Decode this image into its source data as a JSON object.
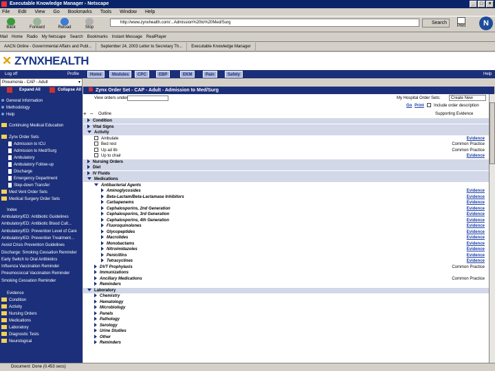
{
  "window": {
    "title": "Executable Knowledge Manager - Netscape"
  },
  "menu": [
    "File",
    "Edit",
    "View",
    "Go",
    "Bookmarks",
    "Tools",
    "Window",
    "Help"
  ],
  "navbar": {
    "back": "Back",
    "forward": "Forward",
    "reload": "Reload",
    "stop": "Stop",
    "url": "http://www.zynxhealth.com/...Admission%20to%20Med/Surg",
    "search": "Search",
    "print": "Print"
  },
  "personal_bar": [
    "Mail",
    "Home",
    "Radio",
    "My Netscape",
    "Search",
    "Bookmarks",
    "Instant Message",
    "RealPlayer"
  ],
  "tabs": [
    "AACN Online - Governmental Affairs and Publ...",
    "September 24, 2003 Letter to Secretary Th...",
    "Executable Knowledge Manager"
  ],
  "brand": {
    "name_a": "ZYNX",
    "name_b": "HEALTH"
  },
  "nav": {
    "logoff": "Log off",
    "profile": "Profile",
    "home": "Home",
    "modules": "Modules",
    "cpc": "CPC",
    "ebp": "EBP",
    "ekm": "EKM",
    "pain": "Pain",
    "safety": "Safety",
    "help": "Help"
  },
  "workflow_select": "Pneumonia - CAP - Adult",
  "left": {
    "expand_all": "Expand All",
    "collapse_all": "Collapse All",
    "top_links": [
      "General Information",
      "Methodology",
      "Help"
    ],
    "continuing": "Continuing Medical Education",
    "order_sets_title": "Zynx Order Sets",
    "order_sets": [
      "Admission to ICU",
      "Admission to Med/Surg",
      "Ambulatory",
      "Ambulatory Follow-up",
      "Discharge",
      "Emergency Department",
      "Step-down Transfer"
    ],
    "other_sets": [
      "Med Vent Order Sets",
      "Medical Surgery Order Sets"
    ],
    "index_title": "Index",
    "index_items": [
      "Ambulatory/ED: Antibiotic Guidelines",
      "Ambulatory/ED: Antibiotic Blood Cult...",
      "Ambulatory/ED: Prevention Level of Care",
      "Ambulatory/ED: Prevention Treatment...",
      "Avoid Crisis Prevention Guidelines",
      "Discharge: Smoking Cessation Reminder",
      "Early Switch to Oral Antibiotics",
      "Influenza Vaccination Reminder",
      "Pneumococcal Vaccination Reminder",
      "Smoking Cessation Reminder"
    ],
    "evidence_title": "Evidence",
    "evidence_items": [
      "Condition",
      "Activity",
      "Nursing Orders",
      "Medications",
      "Laboratory",
      "Diagnostic Tests",
      "Neurological"
    ]
  },
  "main": {
    "header": "Zynx Order Set - CAP - Adult - Admission to Med/Surg",
    "view_label": "View orders under:",
    "my_hospital_label": "My Hospital Order Sets:",
    "create_new": "Create New",
    "go": "Go",
    "print": "Print",
    "include_desc": "Include order description",
    "supporting": "Supporting Evidence",
    "outline_expand": "+",
    "outline_collapse": "−",
    "outline_label": "Outline",
    "evidence_link": "Evidence",
    "common_practice": "Common Practice"
  },
  "orders": [
    {
      "level": 0,
      "label": "Condition",
      "state": "closed",
      "section": true
    },
    {
      "level": 0,
      "label": "Vital Signs",
      "state": "closed",
      "section": true
    },
    {
      "level": 0,
      "label": "Activity",
      "state": "open",
      "section": true
    },
    {
      "level": 1,
      "label": "Ambulate",
      "check": true,
      "right": "ev"
    },
    {
      "level": 1,
      "label": "Bed rest",
      "check": true,
      "right": "cp"
    },
    {
      "level": 1,
      "label": "Up ad lib",
      "check": true,
      "right": "cp"
    },
    {
      "level": 1,
      "label": "Up to chair",
      "check": true,
      "right": "ev"
    },
    {
      "level": 0,
      "label": "Nursing Orders",
      "state": "closed",
      "section": true
    },
    {
      "level": 0,
      "label": "Diet",
      "state": "closed",
      "section": true
    },
    {
      "level": 0,
      "label": "IV Fluids",
      "state": "closed",
      "section": true
    },
    {
      "level": 0,
      "label": "Medications",
      "state": "open",
      "section": true
    },
    {
      "level": 1,
      "label": "Antibacterial Agents",
      "state": "open"
    },
    {
      "level": 2,
      "label": "Aminoglycosides",
      "state": "closed",
      "right": "ev"
    },
    {
      "level": 2,
      "label": "Beta-Lactam/Beta-Lactamase Inhibitors",
      "state": "closed",
      "right": "ev"
    },
    {
      "level": 2,
      "label": "Carbapenems",
      "state": "closed",
      "right": "ev"
    },
    {
      "level": 2,
      "label": "Cephalosporins, 2nd Generation",
      "state": "closed",
      "right": "ev"
    },
    {
      "level": 2,
      "label": "Cephalosporins, 3rd Generation",
      "state": "closed",
      "right": "ev"
    },
    {
      "level": 2,
      "label": "Cephalosporins, 4th Generation",
      "state": "closed",
      "right": "ev"
    },
    {
      "level": 2,
      "label": "Fluoroquinolones",
      "state": "closed",
      "right": "ev"
    },
    {
      "level": 2,
      "label": "Glycopeptides",
      "state": "closed",
      "right": "ev"
    },
    {
      "level": 2,
      "label": "Macrolides",
      "state": "closed",
      "right": "ev"
    },
    {
      "level": 2,
      "label": "Monobactams",
      "state": "closed",
      "right": "ev"
    },
    {
      "level": 2,
      "label": "Nitroimidazoles",
      "state": "closed",
      "right": "ev"
    },
    {
      "level": 2,
      "label": "Penicillins",
      "state": "closed",
      "right": "ev"
    },
    {
      "level": 2,
      "label": "Tetracyclines",
      "state": "closed",
      "right": "ev"
    },
    {
      "level": 1,
      "label": "DVT Prophylaxis",
      "state": "closed",
      "right": "cp"
    },
    {
      "level": 1,
      "label": "Immunizations",
      "state": "closed"
    },
    {
      "level": 1,
      "label": "Ancillary Medications",
      "state": "closed",
      "right": "cp"
    },
    {
      "level": 1,
      "label": "Reminders",
      "state": "closed"
    },
    {
      "level": 0,
      "label": "Laboratory",
      "state": "open",
      "section": true
    },
    {
      "level": 1,
      "label": "Chemistry",
      "state": "closed"
    },
    {
      "level": 1,
      "label": "Hematology",
      "state": "closed"
    },
    {
      "level": 1,
      "label": "Microbiology",
      "state": "closed"
    },
    {
      "level": 1,
      "label": "Panels",
      "state": "closed"
    },
    {
      "level": 1,
      "label": "Pathology",
      "state": "closed"
    },
    {
      "level": 1,
      "label": "Serology",
      "state": "closed"
    },
    {
      "level": 1,
      "label": "Urine Studies",
      "state": "closed"
    },
    {
      "level": 1,
      "label": "Other",
      "state": "closed"
    },
    {
      "level": 1,
      "label": "Reminders",
      "state": "closed"
    }
  ],
  "status": "Document: Done (0.453 secs)"
}
